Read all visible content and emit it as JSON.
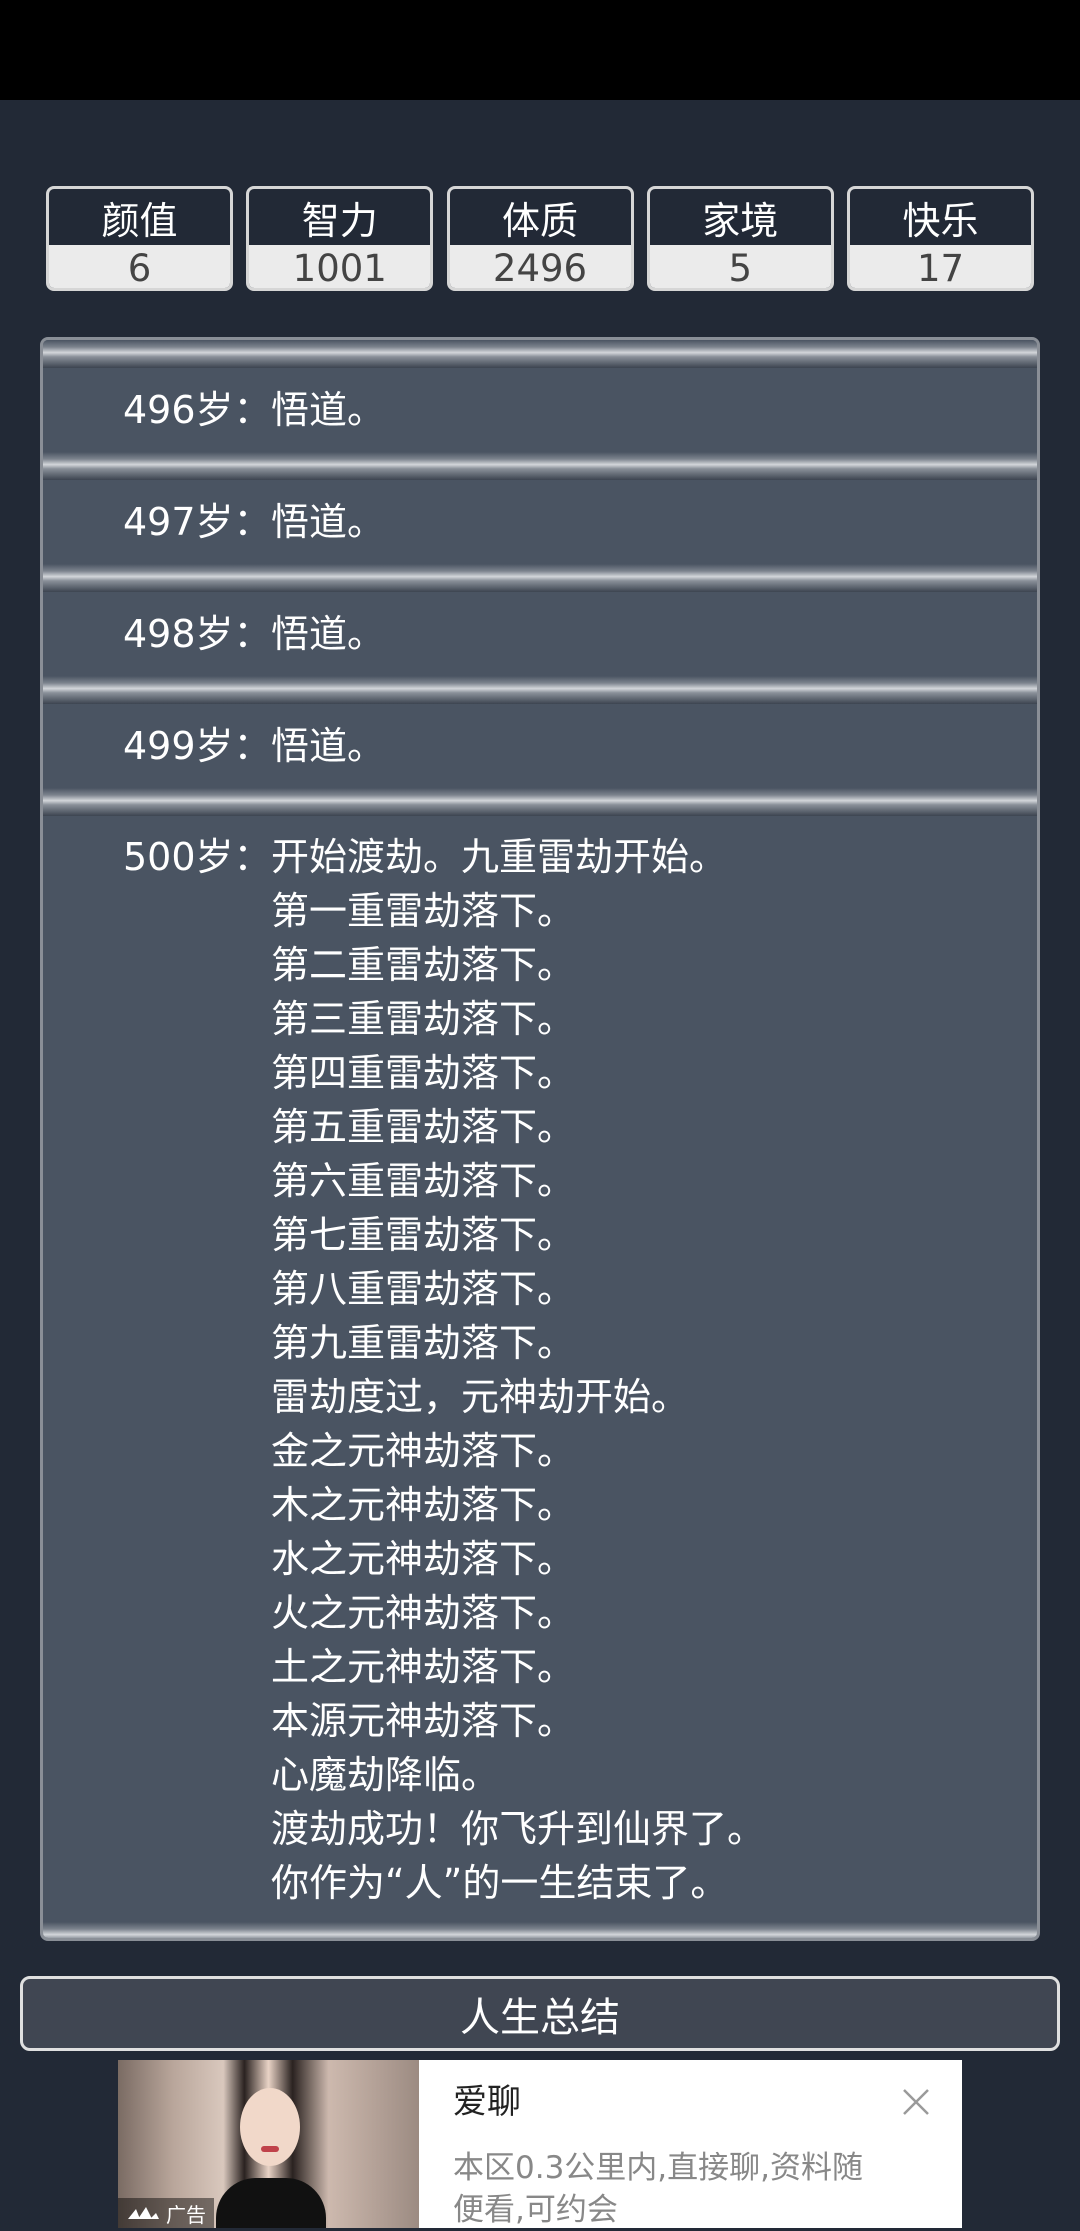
{
  "stats": [
    {
      "name": "颜值",
      "value": "6"
    },
    {
      "name": "智力",
      "value": "1001"
    },
    {
      "name": "体质",
      "value": "2496"
    },
    {
      "name": "家境",
      "value": "5"
    },
    {
      "name": "快乐",
      "value": "17"
    }
  ],
  "log": {
    "entries": [
      {
        "age": "496岁：",
        "lines": [
          "悟道。"
        ]
      },
      {
        "age": "497岁：",
        "lines": [
          "悟道。"
        ]
      },
      {
        "age": "498岁：",
        "lines": [
          "悟道。"
        ]
      },
      {
        "age": "499岁：",
        "lines": [
          "悟道。"
        ]
      },
      {
        "age": "500岁：",
        "lines": [
          "开始渡劫。九重雷劫开始。",
          "第一重雷劫落下。",
          "第二重雷劫落下。",
          "第三重雷劫落下。",
          "第四重雷劫落下。",
          "第五重雷劫落下。",
          "第六重雷劫落下。",
          "第七重雷劫落下。",
          "第八重雷劫落下。",
          "第九重雷劫落下。",
          "雷劫度过，元神劫开始。",
          "金之元神劫落下。",
          "木之元神劫落下。",
          "水之元神劫落下。",
          "火之元神劫落下。",
          "土之元神劫落下。",
          "本源元神劫落下。",
          "心魔劫降临。",
          "渡劫成功！你飞升到仙界了。",
          "你作为“人”的一生结束了。"
        ]
      }
    ]
  },
  "summary_button": {
    "label": "人生总结"
  },
  "ad": {
    "tag": "广告",
    "title": "爱聊",
    "description": "本区0.3公里内,直接聊,资料随便看,可约会"
  }
}
